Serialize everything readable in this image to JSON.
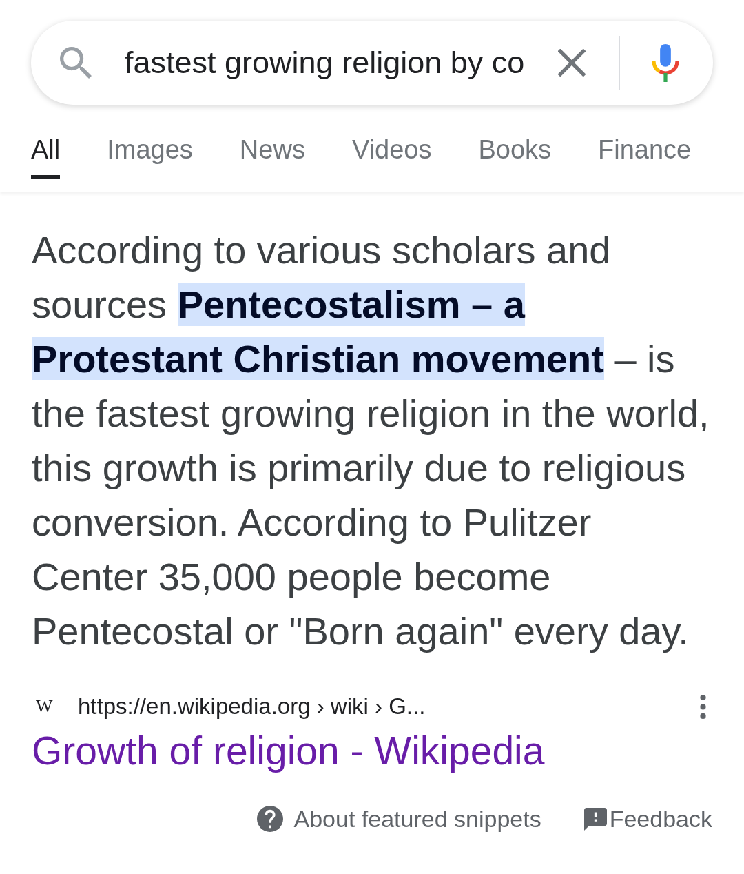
{
  "search": {
    "value": "fastest growing religion by co"
  },
  "tabs": [
    {
      "label": "All",
      "selected": true
    },
    {
      "label": "Images",
      "selected": false
    },
    {
      "label": "News",
      "selected": false
    },
    {
      "label": "Videos",
      "selected": false
    },
    {
      "label": "Books",
      "selected": false
    },
    {
      "label": "Finance",
      "selected": false
    }
  ],
  "snippet": {
    "text": "According to various scholars and sources **Pentecostalism – a Protestant Christian movement** – is the fastest growing religion in the world, this growth is primarily due to religious conversion. According to Pulitzer Center 35,000 people become Pentecostal or \"Born again\" every day."
  },
  "source": {
    "favicon": "W",
    "url": "https://en.wikipedia.org › wiki › G...",
    "title": "Growth of religion - Wikipedia"
  },
  "footer": {
    "about": "About featured snippets",
    "feedback": "Feedback"
  }
}
